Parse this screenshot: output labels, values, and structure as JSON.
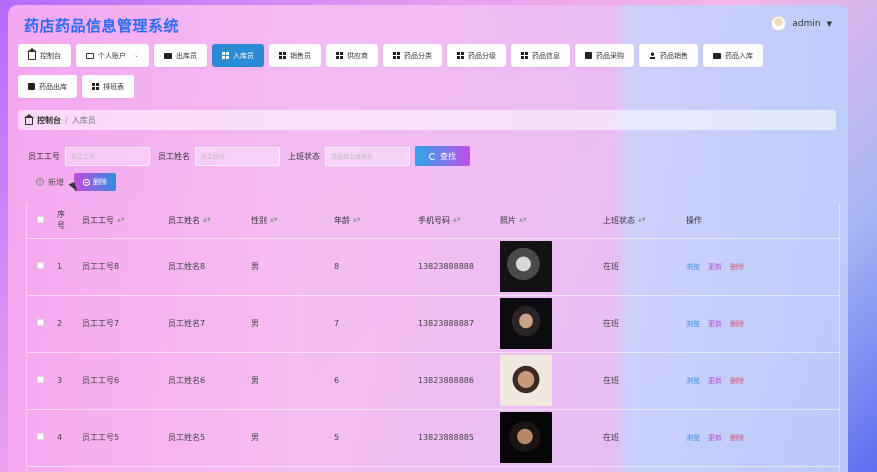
{
  "app": {
    "title": "药店药品信息管理系统"
  },
  "user": {
    "name": "admin"
  },
  "nav": {
    "row1": [
      {
        "label": "控制台",
        "icon": "home-icon"
      },
      {
        "label": "个人账户",
        "icon": "card-icon",
        "dropdown": true
      },
      {
        "label": "出库员",
        "icon": "monitor-icon"
      },
      {
        "label": "入库员",
        "icon": "grid-icon",
        "active": true
      },
      {
        "label": "销售员",
        "icon": "grid-icon"
      },
      {
        "label": "供应商",
        "icon": "grid-icon"
      },
      {
        "label": "药品分类",
        "icon": "grid-icon"
      },
      {
        "label": "药品分级",
        "icon": "grid-icon"
      },
      {
        "label": "药品信息",
        "icon": "grid-icon"
      },
      {
        "label": "药品采购",
        "icon": "check-icon"
      },
      {
        "label": "药品销售",
        "icon": "person-icon"
      },
      {
        "label": "药品入库",
        "icon": "bag-icon"
      }
    ],
    "row2": [
      {
        "label": "药品出库",
        "icon": "box-icon"
      },
      {
        "label": "排班表",
        "icon": "grid-icon"
      }
    ]
  },
  "breadcrumb": {
    "root": "控制台",
    "separator": "/",
    "current": "入库员"
  },
  "search": {
    "id_label": "员工工号",
    "id_placeholder": "员工工号",
    "name_label": "员工姓名",
    "name_placeholder": "员工姓名",
    "status_label": "上班状态",
    "status_placeholder": "请选择上班状态",
    "button": "查找"
  },
  "actions": {
    "add": "新增",
    "delete": "删除"
  },
  "table": {
    "headers": {
      "seq": "序号",
      "id": "员工工号",
      "name": "员工姓名",
      "gender": "性别",
      "age": "年龄",
      "phone": "手机号码",
      "photo": "照片",
      "status": "上班状态",
      "ops": "操作"
    },
    "ops": {
      "view": "浏览",
      "update": "更新",
      "delete": "删除"
    },
    "rows": [
      {
        "seq": "1",
        "id": "员工工号8",
        "name": "员工姓名8",
        "gender": "男",
        "age": "8",
        "phone": "13823888888",
        "status": "在班"
      },
      {
        "seq": "2",
        "id": "员工工号7",
        "name": "员工姓名7",
        "gender": "男",
        "age": "7",
        "phone": "13823888887",
        "status": "在班"
      },
      {
        "seq": "3",
        "id": "员工工号6",
        "name": "员工姓名6",
        "gender": "男",
        "age": "6",
        "phone": "13823888886",
        "status": "在班"
      },
      {
        "seq": "4",
        "id": "员工工号5",
        "name": "员工姓名5",
        "gender": "男",
        "age": "5",
        "phone": "13823888885",
        "status": "在班"
      }
    ]
  },
  "colors": {
    "accent": "#2b8ad6",
    "title": "#2e6cf0",
    "update": "#b34ee0",
    "delete": "#d35a7a"
  }
}
